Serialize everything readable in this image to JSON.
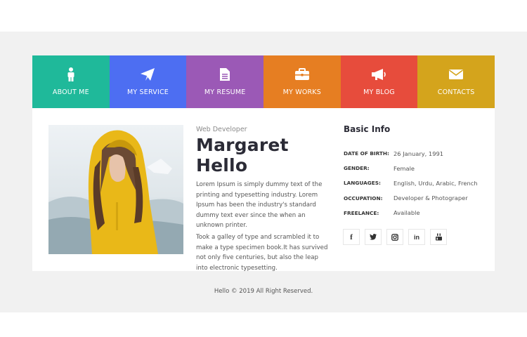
{
  "nav": {
    "items": [
      {
        "label": "ABOUT ME",
        "icon": "person-icon",
        "color": "#1fb99a"
      },
      {
        "label": "MY SERVICE",
        "icon": "paper-plane-icon",
        "color": "#4d6ef2"
      },
      {
        "label": "MY RESUME",
        "icon": "document-icon",
        "color": "#9b59b6"
      },
      {
        "label": "MY WORKS",
        "icon": "briefcase-icon",
        "color": "#e67e22"
      },
      {
        "label": "MY BLOG",
        "icon": "megaphone-icon",
        "color": "#e74c3c"
      },
      {
        "label": "CONTACTS",
        "icon": "envelope-icon",
        "color": "#d4a41c"
      }
    ]
  },
  "profile": {
    "role": "Web Developer",
    "name": "Margaret Hello",
    "paragraphs": [
      "Lorem Ipsum is simply dummy text of the printing and typesetting industry. Lorem Ipsum has been the industry's standard dummy text ever since the when an unknown printer.",
      "Took a galley of type and scrambled it to make a type specimen book.It has survived not only five centuries, but also the leap into electronic typesetting."
    ]
  },
  "basic_info": {
    "heading": "Basic Info",
    "rows": [
      {
        "key": "DATE OF BIRTH:",
        "value": "26 January, 1991"
      },
      {
        "key": "GENDER:",
        "value": "Female"
      },
      {
        "key": "LANGUAGES:",
        "value": "English, Urdu, Arabic, French"
      },
      {
        "key": "OCCUPATION:",
        "value": "Developer & Photograper"
      },
      {
        "key": "FREELANCE:",
        "value": "Available"
      }
    ]
  },
  "social": [
    {
      "icon": "facebook-icon",
      "glyph": "f"
    },
    {
      "icon": "twitter-icon",
      "glyph": ""
    },
    {
      "icon": "instagram-icon",
      "glyph": ""
    },
    {
      "icon": "linkedin-icon",
      "glyph": "in"
    },
    {
      "icon": "youtube-icon",
      "glyph": ""
    }
  ],
  "footer": {
    "text": "Hello © 2019 All Right Reserved."
  }
}
